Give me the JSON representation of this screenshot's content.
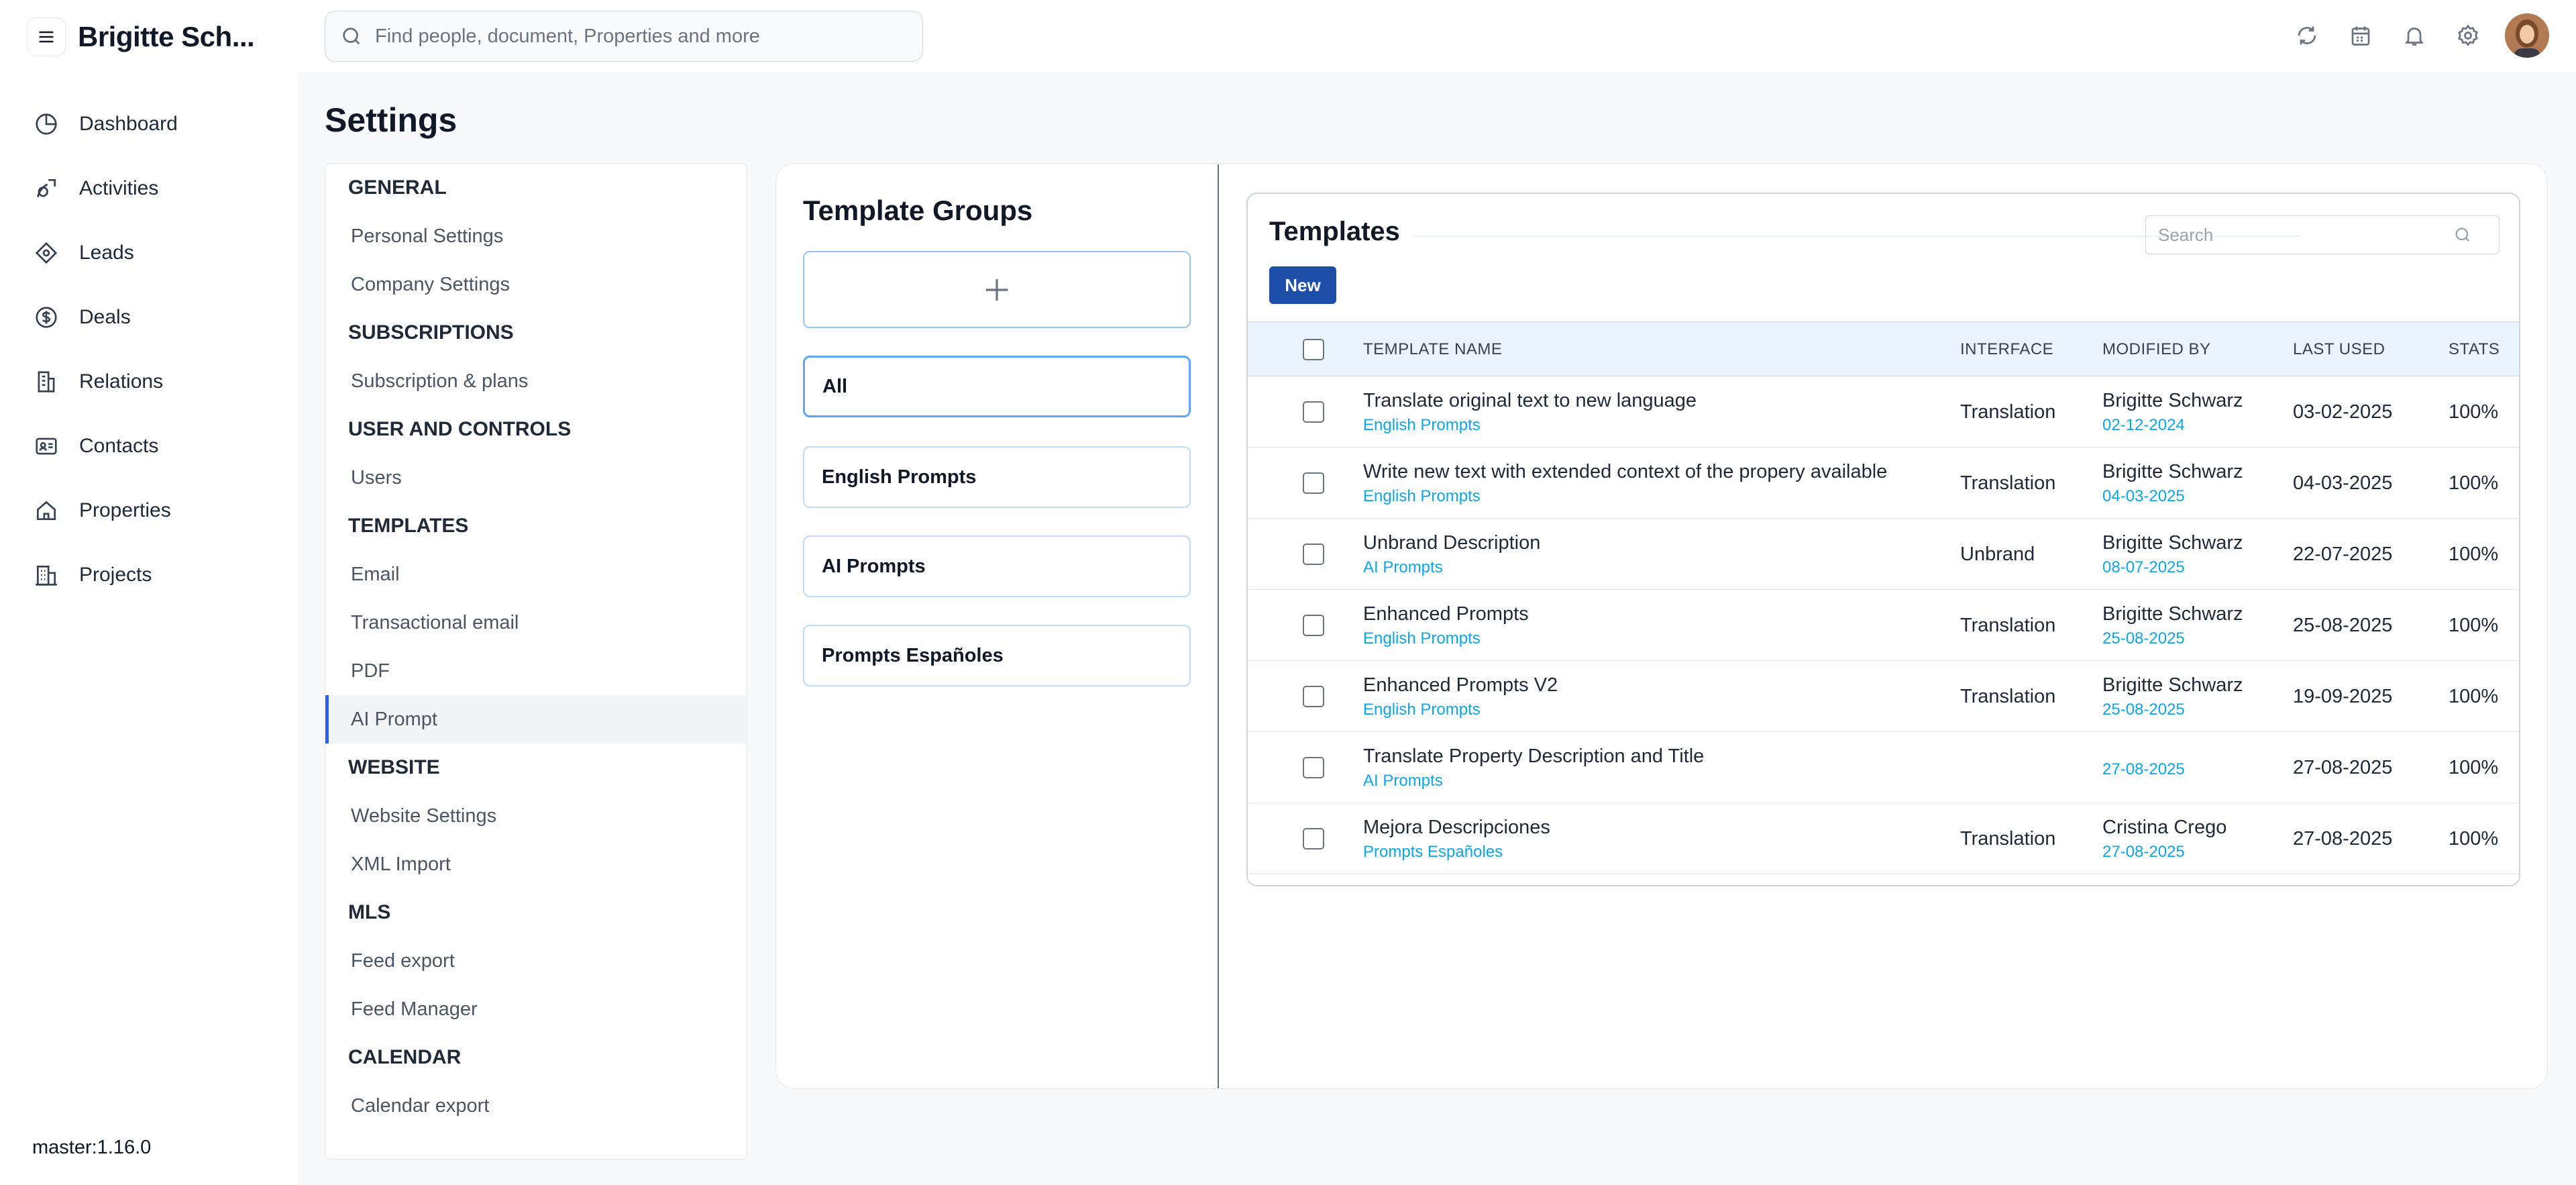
{
  "app": {
    "user_name": "Brigitte Sch...",
    "version": "master:1.16.0"
  },
  "nav": {
    "items": [
      {
        "label": "Dashboard",
        "icon": "dashboard-icon"
      },
      {
        "label": "Activities",
        "icon": "activities-icon"
      },
      {
        "label": "Leads",
        "icon": "leads-icon"
      },
      {
        "label": "Deals",
        "icon": "deals-icon"
      },
      {
        "label": "Relations",
        "icon": "relations-icon"
      },
      {
        "label": "Contacts",
        "icon": "contacts-icon"
      },
      {
        "label": "Properties",
        "icon": "home-icon"
      },
      {
        "label": "Projects",
        "icon": "projects-icon"
      }
    ]
  },
  "search": {
    "placeholder": "Find people, document, Properties and more"
  },
  "page": {
    "title": "Settings"
  },
  "settings_menu": {
    "sections": [
      {
        "title": "GENERAL",
        "items": [
          "Personal Settings",
          "Company Settings"
        ]
      },
      {
        "title": "SUBSCRIPTIONS",
        "items": [
          "Subscription & plans"
        ]
      },
      {
        "title": "USER AND CONTROLS",
        "items": [
          "Users"
        ]
      },
      {
        "title": "TEMPLATES",
        "items": [
          "Email",
          "Transactional email",
          "PDF",
          "AI Prompt"
        ]
      },
      {
        "title": "WEBSITE",
        "items": [
          "Website Settings",
          "XML Import"
        ]
      },
      {
        "title": "MLS",
        "items": [
          "Feed export",
          "Feed Manager"
        ]
      },
      {
        "title": "CALENDAR",
        "items": [
          "Calendar export"
        ]
      }
    ],
    "active_item": "AI Prompt"
  },
  "template_groups": {
    "title": "Template Groups",
    "groups": [
      "All",
      "English Prompts",
      "AI Prompts",
      "Prompts Españoles"
    ],
    "selected": "All"
  },
  "templates": {
    "title": "Templates",
    "search_placeholder": "Search",
    "new_label": "New",
    "columns": [
      "TEMPLATE NAME",
      "INTERFACE",
      "MODIFIED BY",
      "LAST USED",
      "STATS"
    ],
    "rows": [
      {
        "name": "Translate original text to new language",
        "group": "English Prompts",
        "interface": "Translation",
        "modified_by": "Brigitte Schwarz",
        "modified_date": "02-12-2024",
        "last_used": "03-02-2025",
        "stats": "100%"
      },
      {
        "name": "Write new text with extended context of the propery available",
        "group": "English Prompts",
        "interface": "Translation",
        "modified_by": "Brigitte Schwarz",
        "modified_date": "04-03-2025",
        "last_used": "04-03-2025",
        "stats": "100%"
      },
      {
        "name": "Unbrand Description",
        "group": "AI Prompts",
        "interface": "Unbrand",
        "modified_by": "Brigitte Schwarz",
        "modified_date": "08-07-2025",
        "last_used": "22-07-2025",
        "stats": "100%"
      },
      {
        "name": "Enhanced Prompts",
        "group": "English Prompts",
        "interface": "Translation",
        "modified_by": "Brigitte Schwarz",
        "modified_date": "25-08-2025",
        "last_used": "25-08-2025",
        "stats": "100%"
      },
      {
        "name": "Enhanced Prompts V2",
        "group": "English Prompts",
        "interface": "Translation",
        "modified_by": "Brigitte Schwarz",
        "modified_date": "25-08-2025",
        "last_used": "19-09-2025",
        "stats": "100%"
      },
      {
        "name": "Translate Property Description and Title",
        "group": "AI Prompts",
        "interface": "",
        "modified_by": "",
        "modified_date": "27-08-2025",
        "last_used": "27-08-2025",
        "stats": "100%"
      },
      {
        "name": "Mejora Descripciones",
        "group": "Prompts Españoles",
        "interface": "Translation",
        "modified_by": "Cristina Crego",
        "modified_date": "27-08-2025",
        "last_used": "27-08-2025",
        "stats": "100%"
      }
    ]
  },
  "colors": {
    "accent": "#1e4fa8",
    "link": "#0ea5e9",
    "active_border": "#2563eb"
  }
}
